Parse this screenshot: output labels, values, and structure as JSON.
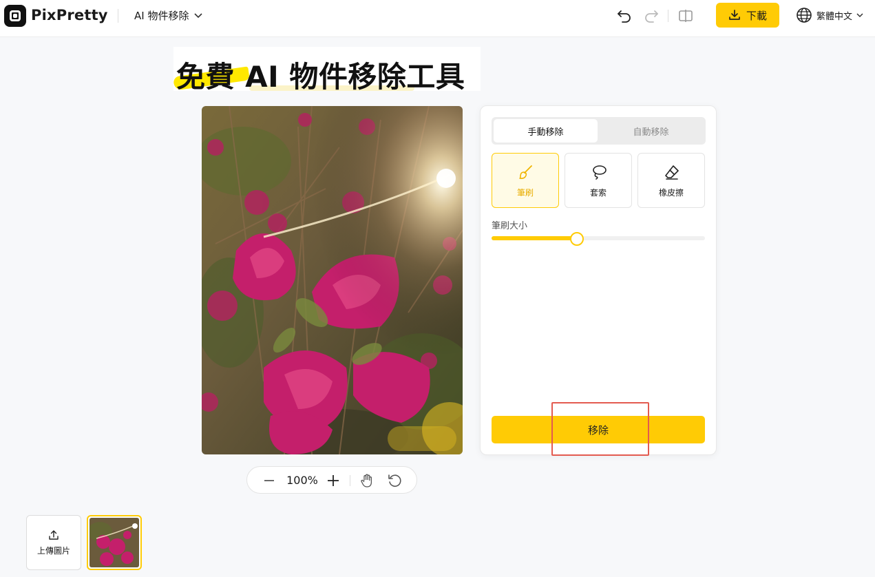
{
  "app": {
    "brand": "PixPretty",
    "tool_menu_label": "AI 物件移除",
    "download_label": "下載",
    "language_label": "繁體中文"
  },
  "page": {
    "title": "免費 AI 物件移除工具"
  },
  "zoom": {
    "percent_label": "100%"
  },
  "panel": {
    "tabs": [
      {
        "label": "手動移除",
        "active": true
      },
      {
        "label": "自動移除",
        "active": false
      }
    ],
    "tools": [
      {
        "label": "筆刷",
        "icon": "brush-icon",
        "active": true
      },
      {
        "label": "套索",
        "icon": "lasso-icon",
        "active": false
      },
      {
        "label": "橡皮擦",
        "icon": "eraser-icon",
        "active": false
      }
    ],
    "brush_size_label": "筆刷大小",
    "brush_size_value": 0.4,
    "remove_label": "移除"
  },
  "bottom": {
    "upload_label": "上傳圖片"
  },
  "colors": {
    "accent": "#ffcb05",
    "highlight": "#e35a4f"
  }
}
